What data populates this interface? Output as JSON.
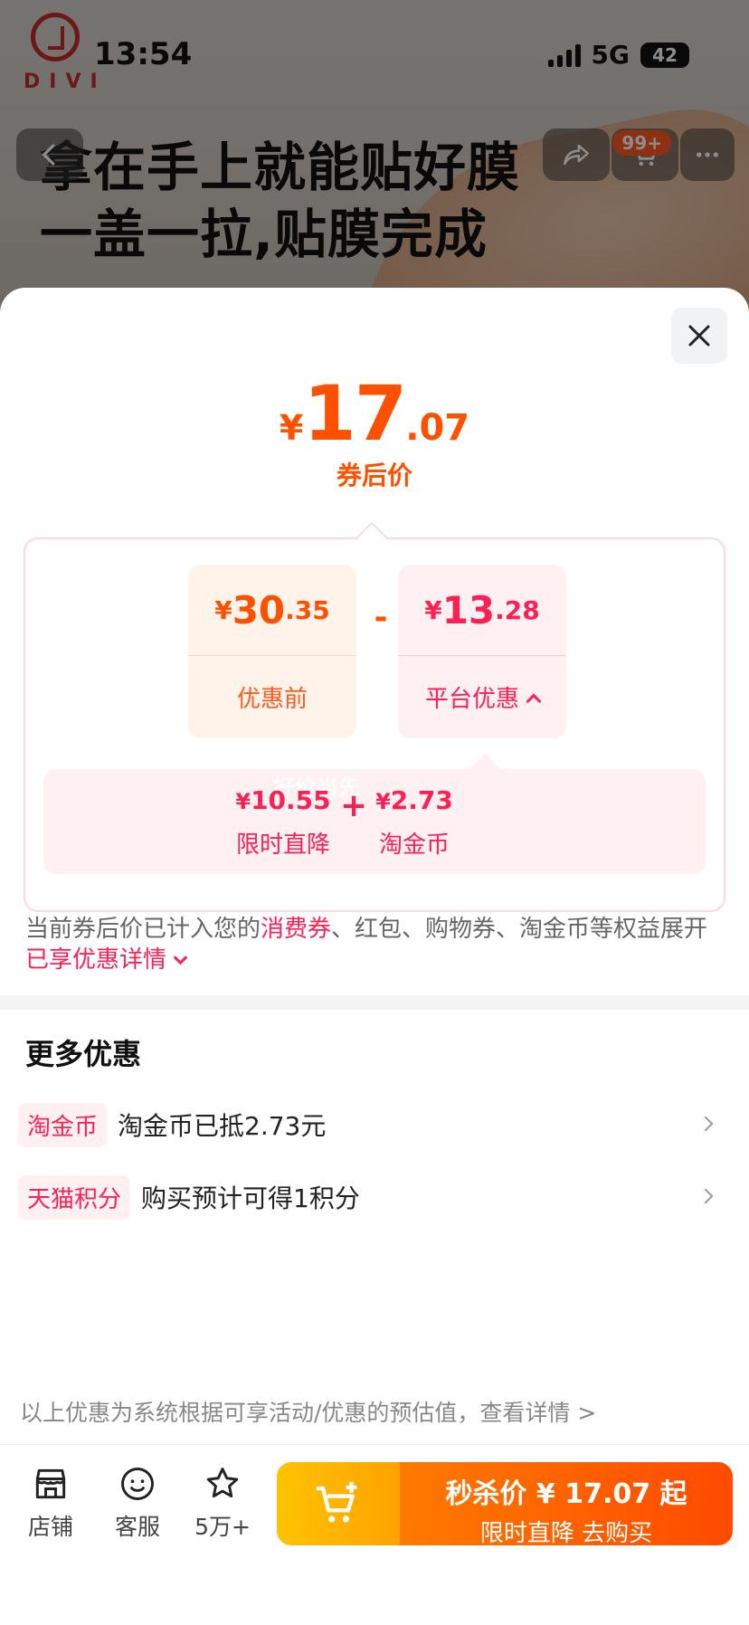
{
  "status_bar": {
    "time": "13:54",
    "network": "5G",
    "battery": "42"
  },
  "background": {
    "brand": "DIVI",
    "headline_1": "拿在手上就能贴好膜",
    "headline_2": "一盖一拉,贴膜完成",
    "cart_badge": "99+"
  },
  "sheet": {
    "price": {
      "currency": "¥",
      "integer": "17",
      "decimal": ".07",
      "label": "券后价"
    },
    "original": {
      "currency": "¥",
      "integer": "30",
      "decimal": ".35",
      "label": "优惠前"
    },
    "operator": "-",
    "platform": {
      "currency": "¥",
      "integer": "13",
      "decimal": ".28",
      "label": "平台优惠"
    },
    "detail": {
      "watermark": "好价当先",
      "plus": "+",
      "items": [
        {
          "currency": "¥",
          "value": "10.55",
          "label": "限时直降"
        },
        {
          "currency": "¥",
          "value": "2.73",
          "label": "淘金币"
        }
      ]
    },
    "note": {
      "text_1": "当前券后价已计入您的",
      "highlight_1": "消费券",
      "text_2": "、红包、购物券、淘金币等权益展开",
      "highlight_2": "已享优惠详情"
    },
    "more": {
      "title": "更多优惠",
      "items": [
        {
          "tag": "淘金币",
          "desc": "淘金币已抵2.73元"
        },
        {
          "tag": "天猫积分",
          "desc": "购买预计可得1积分"
        }
      ]
    },
    "disclaimer": "以上优惠为系统根据可享活动/优惠的预估值，查看详情 >"
  },
  "bottom_bar": {
    "shop": "店铺",
    "service": "客服",
    "favorites": "5万+",
    "buy_line1": "秒杀价 ¥ 17.07 起",
    "buy_line2": "限时直降  去购买"
  },
  "colors": {
    "accent_orange": "#ff5000",
    "accent_red": "#ff1f55",
    "cart_yellow": "#ffc300"
  }
}
